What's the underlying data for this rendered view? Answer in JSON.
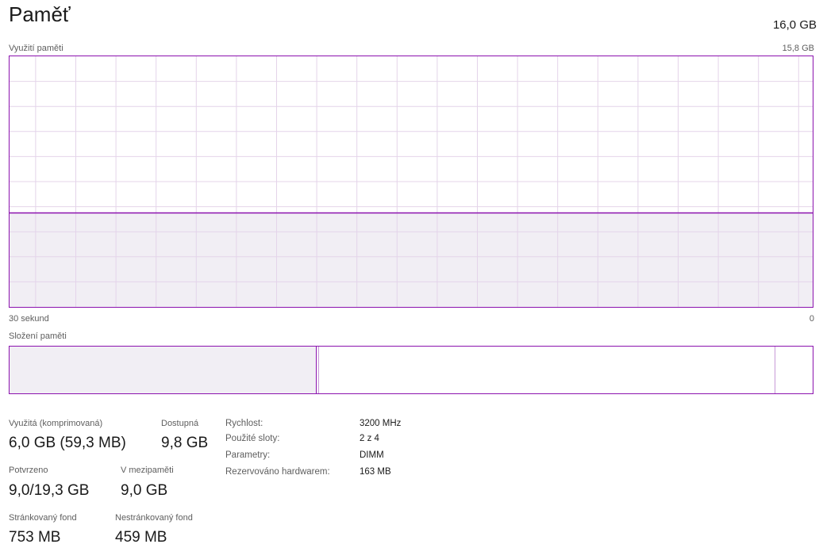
{
  "header": {
    "title": "Paměť",
    "total": "16,0 GB"
  },
  "usage_graph": {
    "label": "Využití paměti",
    "max_label": "15,8 GB",
    "time_left_label": "30 sekund",
    "time_right_label": "0",
    "used_fraction": 0.375,
    "line_color": "#8b12ae",
    "fill_color": "#f1eef4",
    "grid_color": "#e4d4ea"
  },
  "composition": {
    "label": "Složení paměti",
    "in_use_fraction": 0.382,
    "modified_fraction": 0.003,
    "standby_fraction": 0.568,
    "free_fraction": 0.047
  },
  "stats": {
    "in_use_label": "Využitá (komprimovaná)",
    "in_use_value": "6,0 GB (59,3 MB)",
    "available_label": "Dostupná",
    "available_value": "9,8 GB",
    "committed_label": "Potvrzeno",
    "committed_value": "9,0/19,3 GB",
    "cached_label": "V mezipaměti",
    "cached_value": "9,0 GB",
    "paged_label": "Stránkovaný fond",
    "paged_value": "753 MB",
    "nonpaged_label": "Nestránkovaný fond",
    "nonpaged_value": "459 MB"
  },
  "details": [
    {
      "label": "Rychlost:",
      "value": "3200 MHz"
    },
    {
      "label": "Použité sloty:",
      "value": "2 z 4"
    },
    {
      "label": "Parametry:",
      "value": "DIMM"
    },
    {
      "label": "Rezervováno hardwarem:",
      "value": "163 MB"
    }
  ]
}
